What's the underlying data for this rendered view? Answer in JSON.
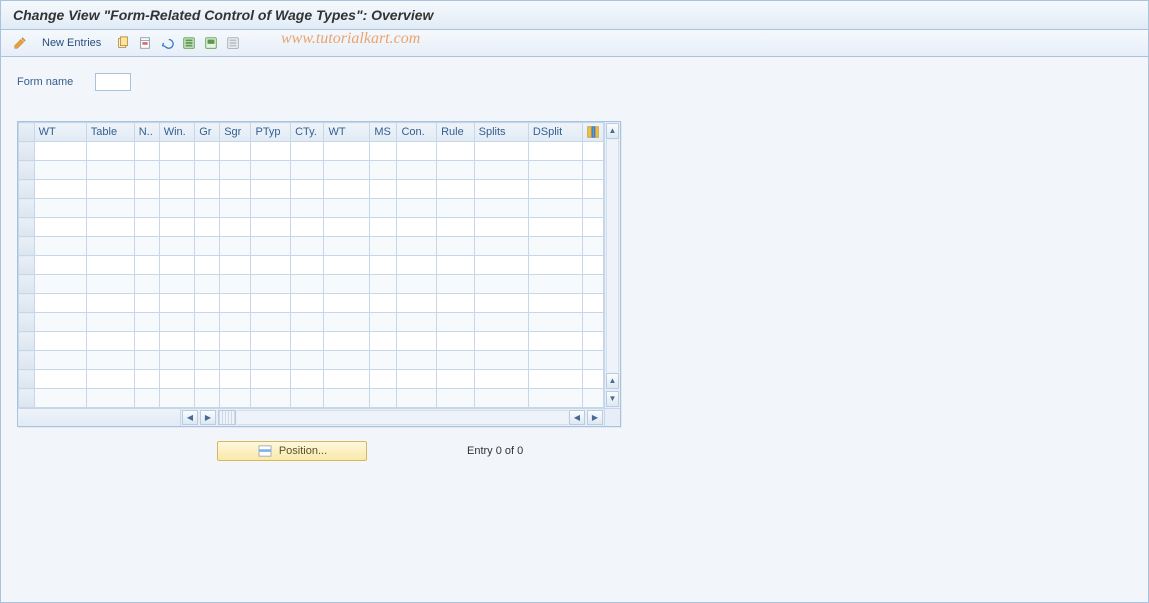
{
  "title": "Change View \"Form-Related Control of Wage Types\": Overview",
  "watermark": "www.tutorialkart.com",
  "toolbar": {
    "new_entries_label": "New Entries",
    "icons": {
      "edit": "edit-pencil-icon",
      "copy": "copy-icon",
      "delete": "delete-icon",
      "undo": "undo-icon",
      "select_all": "select-all-icon",
      "select_block": "select-block-icon",
      "deselect_all": "deselect-all-icon"
    }
  },
  "form": {
    "name_label": "Form name",
    "name_value": ""
  },
  "grid": {
    "columns": [
      "WT",
      "Table",
      "N..",
      "Win.",
      "Gr",
      "Sgr",
      "PTyp",
      "CTy.",
      "WT",
      "MS",
      "Con.",
      "Rule",
      "Splits",
      "DSplit"
    ],
    "row_count": 14
  },
  "footer": {
    "position_label": "Position...",
    "entry_label": "Entry 0 of 0"
  }
}
